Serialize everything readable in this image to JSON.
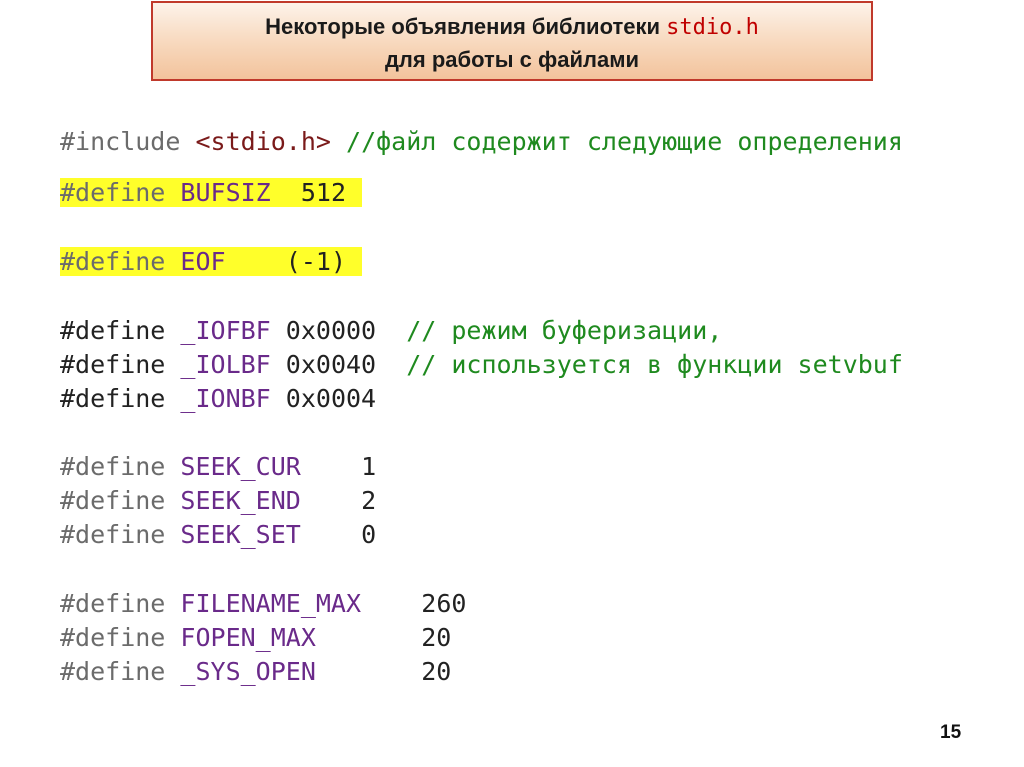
{
  "title": {
    "line1_text": "Некоторые объявления библиотеки ",
    "line1_code": "stdio.h",
    "line2": "для работы с файлами"
  },
  "code": {
    "include": {
      "directive": "#include",
      "header": "<stdio.h>",
      "comment": "//файл содержит следующие определения"
    },
    "bufsiz": {
      "directive": "#define",
      "name": "BUFSIZ",
      "value": "512",
      "highlighted": true
    },
    "eof": {
      "directive": "#define",
      "name": "EOF",
      "value": "(-1)",
      "highlighted": true
    },
    "buffering": [
      {
        "directive": "#define",
        "name": "_IOFBF",
        "value": "0x0000",
        "comment": "// режим буферизации,"
      },
      {
        "directive": "#define",
        "name": "_IOLBF",
        "value": "0x0040",
        "comment": "// используется в функции setvbuf"
      },
      {
        "directive": "#define",
        "name": "_IONBF",
        "value": "0x0004",
        "comment": ""
      }
    ],
    "seek": [
      {
        "directive": "#define",
        "name": "SEEK_CUR",
        "value": "1"
      },
      {
        "directive": "#define",
        "name": "SEEK_END",
        "value": "2"
      },
      {
        "directive": "#define",
        "name": "SEEK_SET",
        "value": "0"
      }
    ],
    "limits": [
      {
        "directive": "#define",
        "name": "FILENAME_MAX",
        "value": "260"
      },
      {
        "directive": "#define",
        "name": "FOPEN_MAX",
        "value": "20"
      },
      {
        "directive": "#define",
        "name": "_SYS_OPEN",
        "value": "20"
      }
    ]
  },
  "colors": {
    "title_border": "#c0392b",
    "highlight": "#ffff2a",
    "comment": "#1f8a1f",
    "macro": "#6a2a8a",
    "header": "#7a1a1a"
  },
  "page_number": "15"
}
